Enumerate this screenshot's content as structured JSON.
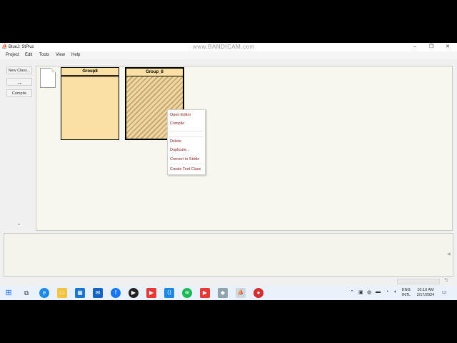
{
  "window": {
    "title": "BlueJ: StPlus",
    "watermark": "www.BANDICAM.com",
    "controls": {
      "minimize": "‒",
      "maximize": "❐",
      "close": "✕"
    }
  },
  "menubar": {
    "items": [
      "Project",
      "Edit",
      "Tools",
      "View",
      "Help"
    ]
  },
  "toolbar": {
    "new_class_label": "New Class...",
    "arrow_label": "→",
    "compile_label": "Compile"
  },
  "diagram": {
    "classes": [
      {
        "name": "Group8"
      },
      {
        "name": "Group_8"
      }
    ]
  },
  "context_menu": {
    "items": [
      "Open Editor",
      "Compile",
      "Delete",
      "Duplicate...",
      "Convert to Stride",
      "Create Test Class"
    ]
  },
  "taskbar": {
    "time": "10:10 AM",
    "date": "2/17/2024",
    "lang_top": "ENG",
    "lang_bottom": "INTL"
  },
  "colors": {
    "class_fill": "#fbe0a6",
    "diagram_bg": "#f7f7ef",
    "context_text": "#8b1a1a"
  }
}
